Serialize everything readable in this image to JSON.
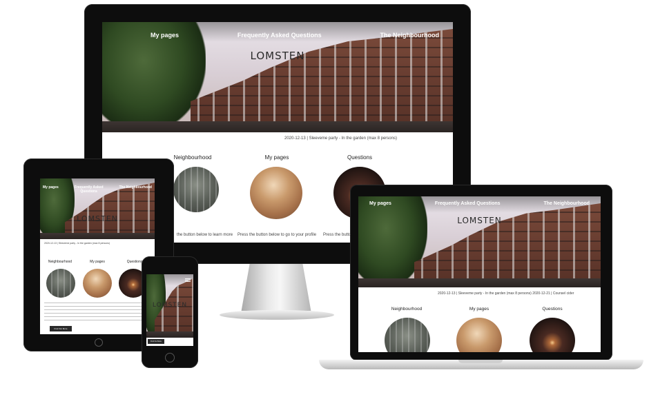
{
  "site": {
    "brand": "LOMSTEN",
    "nav": {
      "my_pages": "My pages",
      "faq": "Frequently Asked Questions",
      "faq_short": "Frequently Asked Questions",
      "neighbourhood": "The Neighbourhood"
    },
    "announcement": "2020-12-13 | Sleeveme party - In the garden (max 8 persons)",
    "announcement_laptop": "2020-12-13 | Sleeveme party - In the garden (max 8 persons)   2020-12-21 | Counsel cider",
    "sections": {
      "neighbourhood": "Neighbourhood",
      "my_pages": "My pages",
      "questions": "Questions"
    },
    "captions": {
      "neighbourhood": "the button below to learn more",
      "my_pages": "Press the button below to go to your profile",
      "questions": "Press the butto"
    },
    "button": "Find Out More"
  },
  "colors": {
    "device_frame": "#0d0d0d",
    "nav_text": "#ffffff",
    "brand_text": "#2a2a2a"
  }
}
